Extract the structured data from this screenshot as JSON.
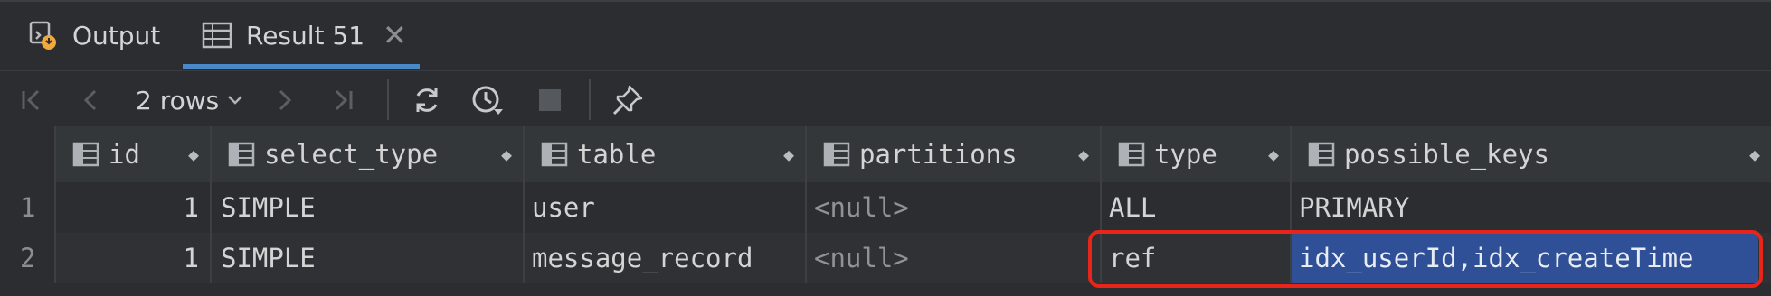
{
  "tabs": {
    "output_label": "Output",
    "result_label": "Result 51",
    "close_glyph": "✕"
  },
  "toolbar": {
    "rows_label": "2 rows",
    "icons": [
      "first-page-icon",
      "prev-page-icon",
      "next-page-icon",
      "last-page-icon",
      "refresh-icon",
      "history-icon",
      "stop-icon",
      "pin-icon"
    ]
  },
  "grid": {
    "columns": [
      "id",
      "select_type",
      "table",
      "partitions",
      "type",
      "possible_keys"
    ],
    "rows": [
      {
        "rownum": "1",
        "id": "1",
        "select_type": "SIMPLE",
        "table": "user",
        "partitions": "<null>",
        "type": "ALL",
        "possible_keys": "PRIMARY"
      },
      {
        "rownum": "2",
        "id": "1",
        "select_type": "SIMPLE",
        "table": "message_record",
        "partitions": "<null>",
        "type": "ref",
        "possible_keys": "idx_userId,idx_createTime"
      }
    ]
  },
  "colors": {
    "background": "#2b2d30",
    "accent": "#4a88c7",
    "selection": "#2f4f96",
    "highlight_border": "#e8251a"
  }
}
